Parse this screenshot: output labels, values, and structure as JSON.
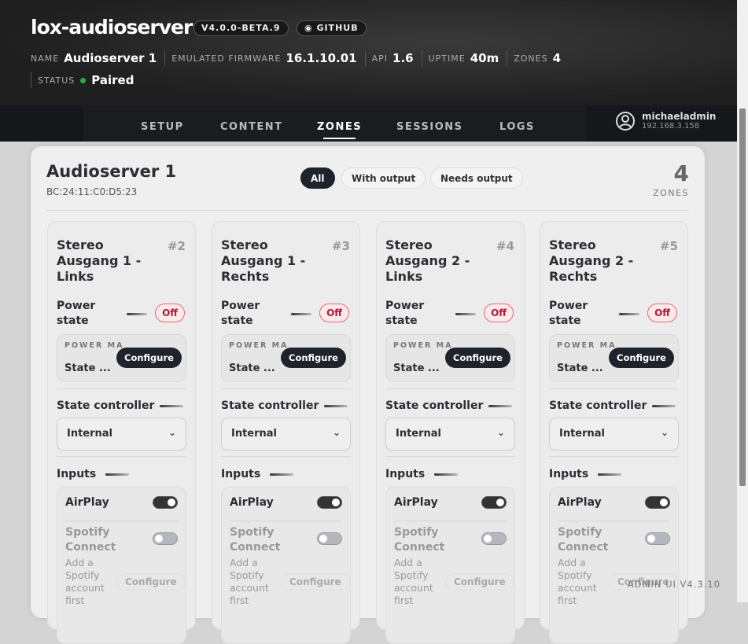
{
  "header": {
    "title": "lox-audioserver",
    "version": "V4.0.0-BETA.9",
    "github": "GITHUB",
    "meta": [
      {
        "label": "NAME",
        "value": "Audioserver 1"
      },
      {
        "label": "EMULATED FIRMWARE",
        "value": "16.1.10.01"
      },
      {
        "label": "API",
        "value": "1.6"
      },
      {
        "label": "UPTIME",
        "value": "40m"
      },
      {
        "label": "ZONES",
        "value": "4"
      }
    ],
    "status_label": "STATUS",
    "status_value": "Paired"
  },
  "nav": {
    "tabs": [
      "SETUP",
      "CONTENT",
      "ZONES",
      "SESSIONS",
      "LOGS"
    ],
    "active": "ZONES"
  },
  "user": {
    "name": "michaeladmin",
    "ip": "192.168.3.158"
  },
  "panel": {
    "title": "Audioserver 1",
    "mac": "BC:24:11:C0:D5:23",
    "filters": [
      "All",
      "With output",
      "Needs output"
    ],
    "count": "4",
    "count_label": "ZONES"
  },
  "zones": [
    {
      "name": "Stereo Ausgang 1 - Links",
      "num": "#2"
    },
    {
      "name": "Stereo Ausgang 1 - Rechts",
      "num": "#3"
    },
    {
      "name": "Stereo Ausgang 2 - Links",
      "num": "#4"
    },
    {
      "name": "Stereo Ausgang 2 - Rechts",
      "num": "#5"
    }
  ],
  "card": {
    "power_label": "Power state",
    "power_value": "Off",
    "pm_label": "POWER MANAGEMENT",
    "pm_state": "State ...",
    "configure": "Configure",
    "state_controller": "State controller",
    "controller_value": "Internal",
    "inputs": "Inputs",
    "airplay": "AirPlay",
    "spotify": "Spotify Connect",
    "spotify_hint": "Add a Spotify account first"
  },
  "footer": {
    "version": "ADMIN UI V4.3.10"
  },
  "colors": {
    "status": "#22b24c",
    "off": "#b0183a",
    "dark": "#1f232b"
  }
}
